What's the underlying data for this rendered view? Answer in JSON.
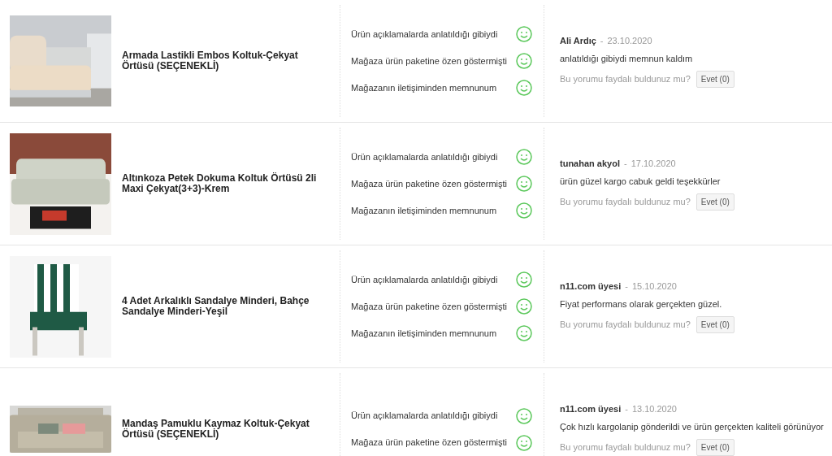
{
  "reviews": [
    {
      "product": "Armada Lastikli Embos Koltuk-Çekyat Örtüsü (SEÇENEKLİ)",
      "picture": {
        "kind": "picture"
      },
      "criteria": [
        {
          "label": "Ürün açıklamalarda anlatıldığı gibiydi",
          "satisfied": true
        },
        {
          "label": "Mağaza ürün paketine özen göstermişti",
          "satisfied": true
        },
        {
          "label": "Mağazanın iletişiminden memnunum",
          "satisfied": true
        }
      ],
      "author": "Ali Ardıç",
      "separator": "-",
      "date": "23.10.2020",
      "comment": "anlatıldığı gibiydi memnun kaldım",
      "helpful_question": "Bu yorumu faydalı buldunuz mu?",
      "helpful_button": "Evet (0)"
    },
    {
      "product": "Altınkoza Petek Dokuma Koltuk Örtüsü 2li Maxi Çekyat(3+3)-Krem",
      "picture": {
        "kind": "picture"
      },
      "criteria": [
        {
          "label": "Ürün açıklamalarda anlatıldığı gibiydi",
          "satisfied": true
        },
        {
          "label": "Mağaza ürün paketine özen göstermişti",
          "satisfied": true
        },
        {
          "label": "Mağazanın iletişiminden memnunum",
          "satisfied": true
        }
      ],
      "author": "tunahan akyol",
      "separator": "-",
      "date": "17.10.2020",
      "comment": "ürün güzel kargo cabuk geldi teşekkürler",
      "helpful_question": "Bu yorumu faydalı buldunuz mu?",
      "helpful_button": "Evet (0)"
    },
    {
      "product": "4 Adet Arkalıklı Sandalye Minderi, Bahçe Sandalye Minderi-Yeşil",
      "picture": {
        "kind": "picture"
      },
      "criteria": [
        {
          "label": "Ürün açıklamalarda anlatıldığı gibiydi",
          "satisfied": true
        },
        {
          "label": "Mağaza ürün paketine özen göstermişti",
          "satisfied": true
        },
        {
          "label": "Mağazanın iletişiminden memnunum",
          "satisfied": true
        }
      ],
      "author": "n11.com üyesi",
      "separator": "-",
      "date": "15.10.2020",
      "comment": "Fiyat performans olarak gerçekten güzel.",
      "helpful_question": "Bu yorumu faydalı buldunuz mu?",
      "helpful_button": "Evet (0)"
    },
    {
      "product": "Mandaş Pamuklu Kaymaz Koltuk-Çekyat Örtüsü (SEÇENEKLİ)",
      "picture": {
        "kind": "picture"
      },
      "criteria": [
        {
          "label": "Ürün açıklamalarda anlatıldığı gibiydi",
          "satisfied": true
        },
        {
          "label": "Mağaza ürün paketine özen göstermişti",
          "satisfied": true
        }
      ],
      "author": "n11.com üyesi",
      "separator": "-",
      "date": "13.10.2020",
      "comment": "Çok hızlı kargolanip gönderildi ve ürün gerçekten kaliteli görünüyor",
      "helpful_question": "Bu yorumu faydalı buldunuz mu?",
      "helpful_button": "Evet (0)"
    }
  ]
}
